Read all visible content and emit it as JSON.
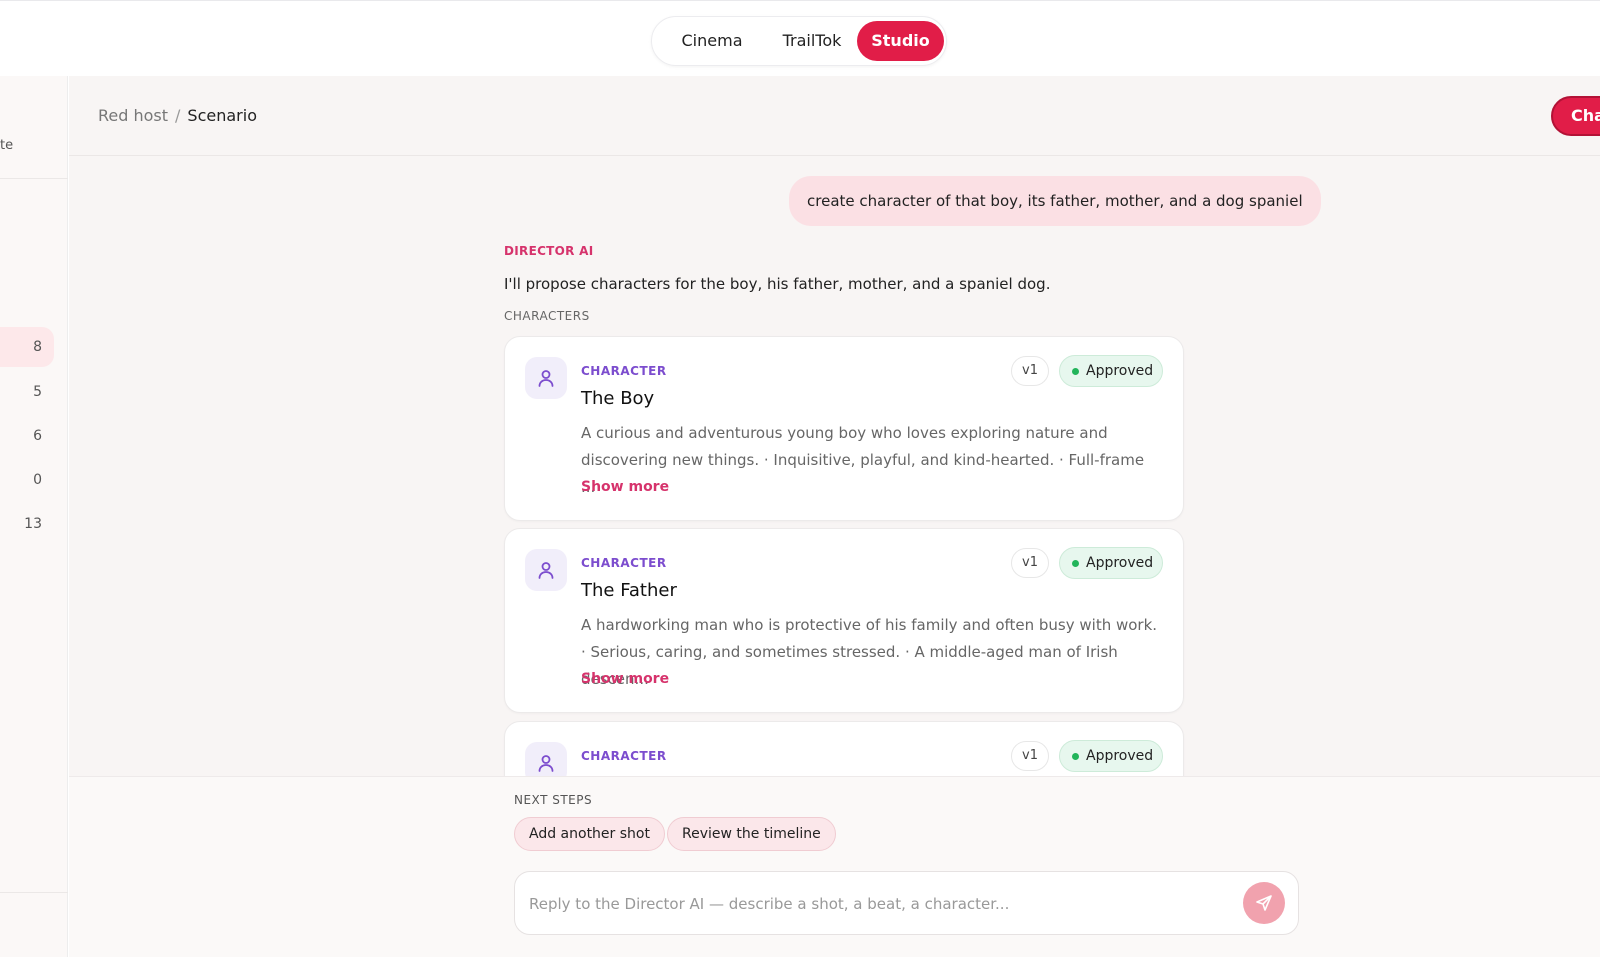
{
  "topbar": {
    "tabs": [
      {
        "label": "Cinema"
      },
      {
        "label": "TrailTok"
      },
      {
        "label": "Studio"
      }
    ]
  },
  "sidebar": {
    "cut_label": "te",
    "counts": [
      "8",
      "5",
      "6",
      "0",
      "13"
    ]
  },
  "header": {
    "breadcrumb_parent": "Red host",
    "breadcrumb_sep": "/",
    "breadcrumb_current": "Scenario",
    "action_label": "Cha"
  },
  "chat": {
    "user_message": "create character of that boy, its father, mother, and a dog spaniel",
    "ai_label": "DIRECTOR AI",
    "ai_text": "I'll propose characters for the boy, his father, mother, and a spaniel dog.",
    "characters_label": "CHARACTERS",
    "cards": [
      {
        "kicker": "CHARACTER",
        "title": "The Boy",
        "desc": "A curious and adventurous young boy who loves exploring nature and discovering new things. · Inquisitive, playful, and kind-hearted. · Full-frame ...",
        "more": "Show more",
        "version": "v1",
        "status": "Approved"
      },
      {
        "kicker": "CHARACTER",
        "title": "The Father",
        "desc": "A hardworking man who is protective of his family and often busy with work. · Serious, caring, and sometimes stressed. · A middle-aged man of Irish descen...",
        "more": "Show more",
        "version": "v1",
        "status": "Approved"
      },
      {
        "kicker": "CHARACTER",
        "title": "",
        "desc": "",
        "more": "",
        "version": "v1",
        "status": "Approved"
      }
    ]
  },
  "composer": {
    "next_steps_label": "NEXT STEPS",
    "chips": [
      "Add another shot",
      "Review the timeline"
    ],
    "placeholder": "Reply to the Director AI — describe a shot, a beat, a character...",
    "value": ""
  },
  "icons": {
    "card_icon": "person-icon",
    "send_icon": "send-icon"
  },
  "colors": {
    "accent": "#e11d48",
    "status_green": "#22b45a",
    "kicker_purple": "#7c4dce"
  }
}
